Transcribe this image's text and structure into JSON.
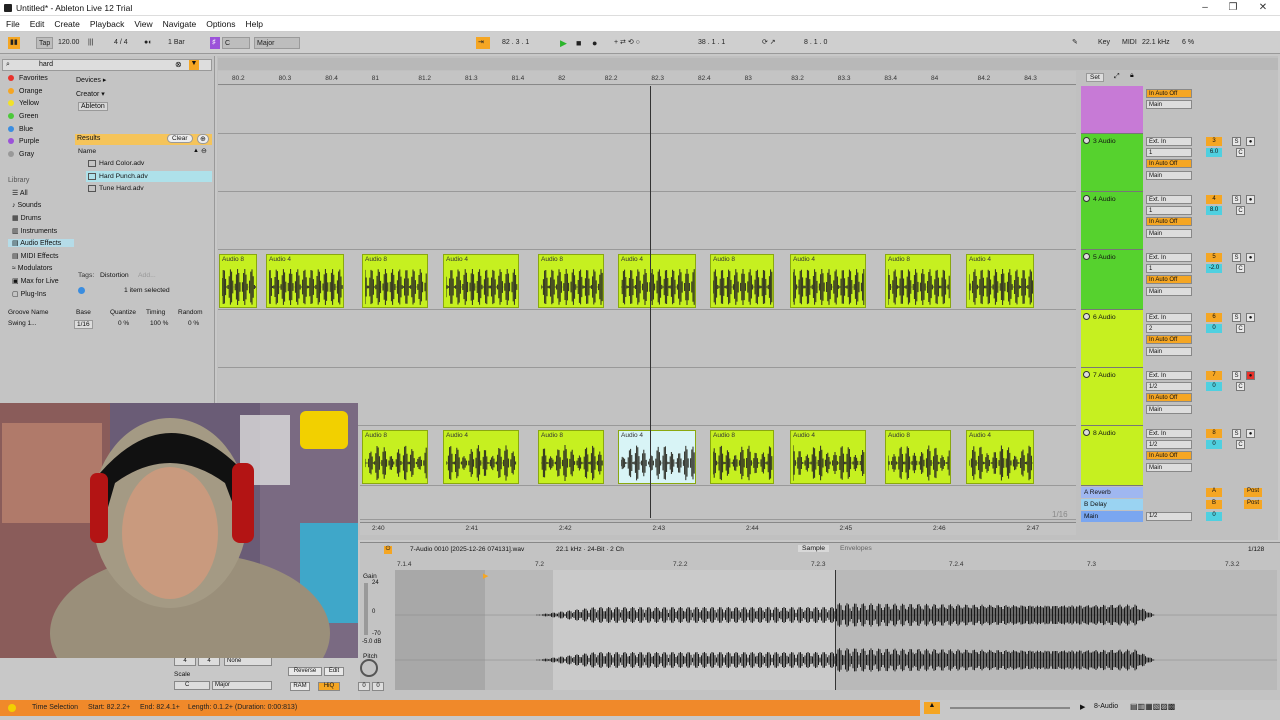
{
  "window": {
    "title": "Untitled* - Ableton Live 12 Trial"
  },
  "menu": [
    "File",
    "Edit",
    "Create",
    "Playback",
    "View",
    "Navigate",
    "Options",
    "Help"
  ],
  "control_bar": {
    "tap": "Tap",
    "tempo": "120.00",
    "signature": "4 / 4",
    "quantize": "1 Bar",
    "key": "C",
    "scale": "Major",
    "position": "82 . 3 . 1",
    "loop_start": "38 . 1 . 1",
    "loop_length": "8 . 1 . 0",
    "key_label": "Key",
    "midi_label": "MIDI",
    "sample_rate": "22.1 kHz",
    "cpu": "6 %"
  },
  "browser": {
    "search_value": "hard",
    "collections": [
      {
        "label": "Favorites",
        "color": "#e8322b"
      },
      {
        "label": "Orange",
        "color": "#f5a623"
      },
      {
        "label": "Yellow",
        "color": "#f2e227"
      },
      {
        "label": "Green",
        "color": "#4cc93a"
      },
      {
        "label": "Blue",
        "color": "#3a8de0"
      },
      {
        "label": "Purple",
        "color": "#9b52d9"
      },
      {
        "label": "Gray",
        "color": "#999999"
      }
    ],
    "library_header": "Library",
    "library": [
      "All",
      "Sounds",
      "Drums",
      "Instruments",
      "Audio Effects",
      "MIDI Effects",
      "Modulators",
      "Max for Live",
      "Plug-Ins"
    ],
    "filters": {
      "devices": "Devices ▸",
      "creator": "Creator ▾",
      "ableton": "Ableton"
    },
    "results_label": "Results",
    "clear_label": "Clear",
    "name_header": "Name",
    "results": [
      "Hard Color.adv",
      "Hard Punch.adv",
      "Tune Hard.adv"
    ],
    "tags_label": "Tags:",
    "tag": "Distortion",
    "add_label": "Add...",
    "selection_status": "1 item selected"
  },
  "groove": {
    "headers": [
      "Groove Name",
      "Base",
      "Quantize",
      "Timing",
      "Random"
    ],
    "row": {
      "name": "Swing 1...",
      "base": "1/16",
      "quantize": "0 %",
      "timing": "100 %",
      "random": "0 %"
    }
  },
  "ruler": [
    "80.2",
    "80.3",
    "80.4",
    "81",
    "81.2",
    "81.3",
    "81.4",
    "82",
    "82.2",
    "82.3",
    "82.4",
    "83",
    "83.2",
    "83.3",
    "83.4",
    "84",
    "84.2",
    "84.3"
  ],
  "time_ruler": [
    "2:40",
    "2:41",
    "2:42",
    "2:43",
    "2:44",
    "2:45",
    "2:46",
    "2:47"
  ],
  "grid": "1/16",
  "set_label": "Set",
  "tracks": [
    {
      "name": "",
      "color": "#c77ad6",
      "routing": [
        "In",
        "Auto",
        "Off"
      ],
      "out": "Main",
      "num": "",
      "vol": ""
    },
    {
      "name": "3 Audio",
      "color": "#56d22e",
      "input": "Ext. In",
      "channel": "1",
      "out": "Main",
      "num": "3",
      "vol": "6.0"
    },
    {
      "name": "4 Audio",
      "color": "#56d22e",
      "input": "Ext. In",
      "channel": "1",
      "out": "Main",
      "num": "4",
      "vol": "8.0"
    },
    {
      "name": "5 Audio",
      "color": "#56d22e",
      "input": "Ext. In",
      "channel": "1",
      "out": "Main",
      "num": "5",
      "vol": "-2.0"
    },
    {
      "name": "6 Audio",
      "color": "#c6f020",
      "input": "Ext. In",
      "channel": "2",
      "out": "Main",
      "num": "6",
      "vol": "0"
    },
    {
      "name": "7 Audio",
      "color": "#c6f020",
      "input": "Ext. In",
      "channel": "1/2",
      "out": "Main",
      "num": "7",
      "vol": "0"
    },
    {
      "name": "8 Audio",
      "color": "#c6f020",
      "input": "Ext. In",
      "channel": "1/2",
      "out": "Main",
      "num": "8",
      "vol": "0"
    }
  ],
  "returns": [
    {
      "name": "A Reverb",
      "letter": "A",
      "post": "Post"
    },
    {
      "name": "B Delay",
      "letter": "B",
      "post": "Post"
    },
    {
      "name": "Main",
      "out": "1/2",
      "vol": "0"
    }
  ],
  "clips_track5": [
    "Audio 8",
    "Audio 4",
    "Audio 8",
    "Audio 4",
    "Audio 8",
    "Audio 4",
    "Audio 8",
    "Audio 4",
    "Audio 8",
    "Audio 4"
  ],
  "clips_track8": [
    "Audio 8",
    "Audio 4",
    "Audio 8",
    "Audio 4",
    "Audio 8",
    "Audio 4",
    "Audio 8",
    "Audio 4"
  ],
  "detail": {
    "clip_name": "7-Audio 0010 [2025-12-26 074131].wav",
    "clip_info": "22.1 kHz · 24-Bit · 2 Ch",
    "tab_sample": "Sample",
    "tab_envelopes": "Envelopes",
    "grid": "1/128",
    "ruler": [
      "7.1.4",
      "7.2",
      "7.2.2",
      "7.2.3",
      "7.2.4",
      "7.3",
      "7.3.2"
    ],
    "gain_label": "Gain",
    "gain_scale": [
      "24",
      "0",
      "-70"
    ],
    "gain_value": "-5.0 dB",
    "pitch_label": "Pitch",
    "sig": [
      "4",
      "4"
    ],
    "none": "None",
    "reverse": "Reverse",
    "edit": "Edit",
    "scale_label": "Scale",
    "key": "C",
    "scale": "Major",
    "ram": "RAM",
    "hiq": "HiQ",
    "pitch_vals": [
      "0",
      "0"
    ]
  },
  "status": {
    "text": "Time Selection",
    "start": "Start: 82.2.2+",
    "end": "End: 82.4.1+",
    "length": "Length: 0.1.2+ (Duration: 0:00:813)",
    "track": "8-Audio"
  },
  "colors": {
    "accent": "#f5a623",
    "clip": "#c6f020",
    "status": "#f0892a",
    "selection": "#d8f4f6"
  }
}
